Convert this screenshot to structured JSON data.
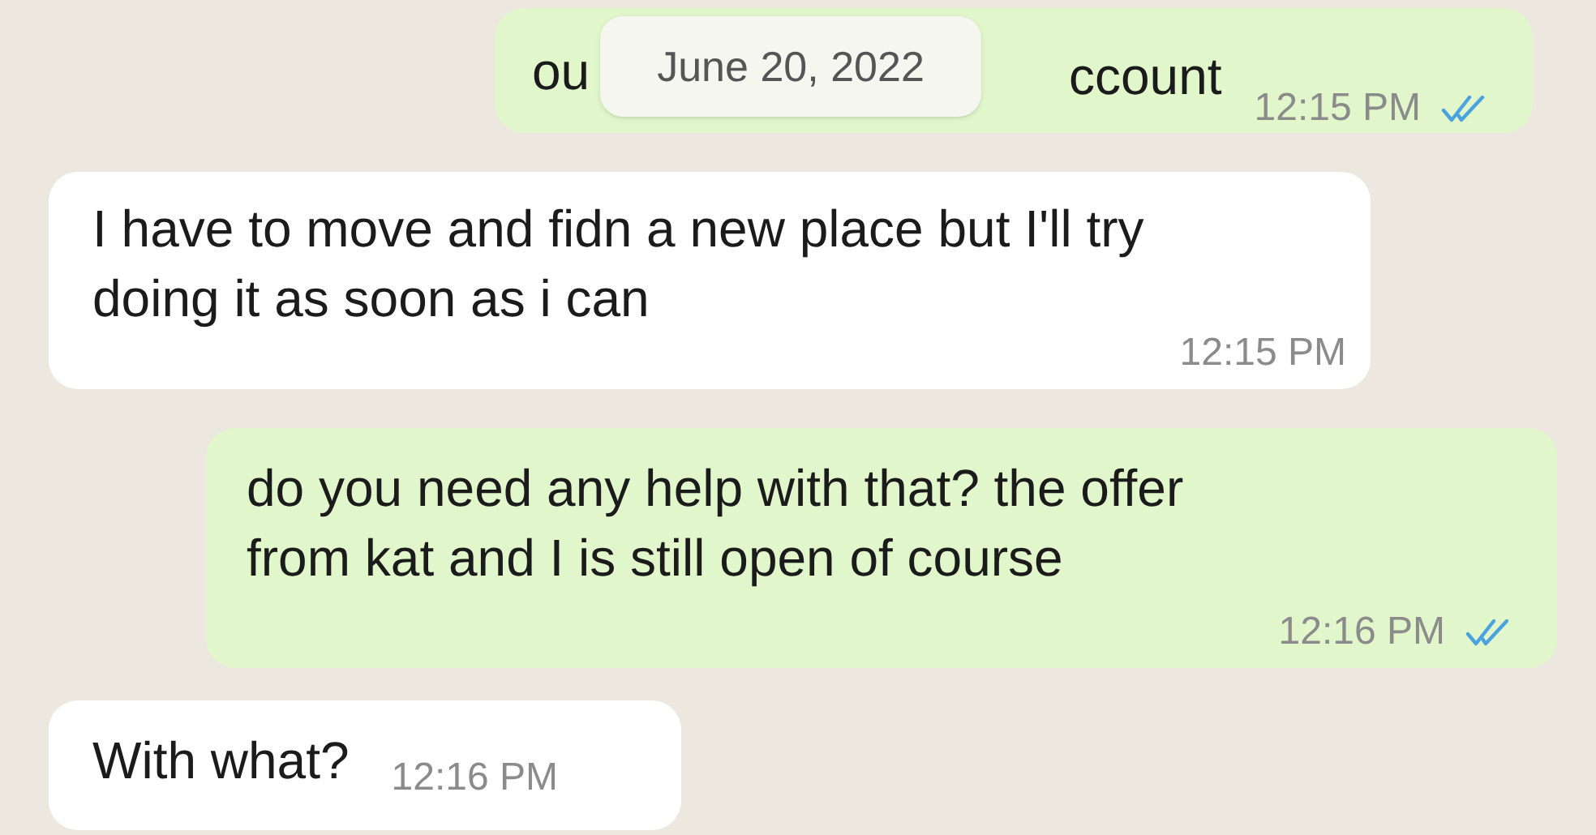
{
  "date_chip": "June 20, 2022",
  "messages": [
    {
      "kind": "out_covered",
      "fragments": [
        "ou",
        "ccount"
      ],
      "time": "12:15 PM",
      "read": true
    },
    {
      "kind": "in",
      "text": "I have to move and fidn a new place but I'll try doing it as soon as i can",
      "time": "12:15 PM"
    },
    {
      "kind": "out",
      "text": "do you need any help with that? the offer from kat and I is still open of course",
      "time": "12:16 PM",
      "read": true
    },
    {
      "kind": "in_short",
      "text": "With what?",
      "time": "12:16 PM"
    }
  ]
}
